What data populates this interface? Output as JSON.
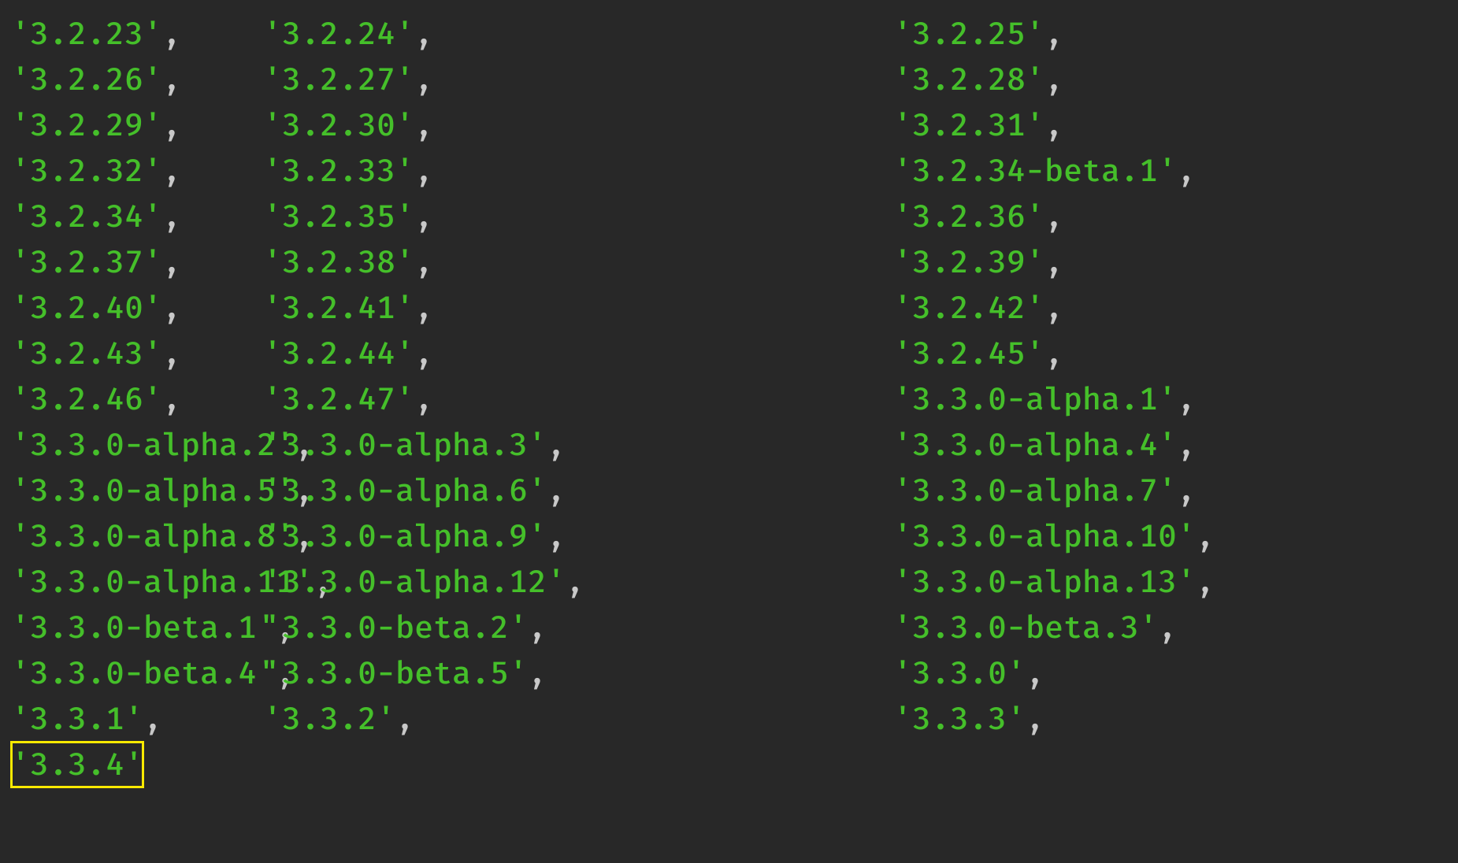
{
  "colors": {
    "bg": "#282828",
    "string": "#45bf2a",
    "punct": "#c8c8c8",
    "selection": "#f9e900"
  },
  "selected_row": 16,
  "selected_col": 0,
  "rows": [
    {
      "c1": "3.2.23",
      "c2": "3.2.24",
      "c3": "3.2.25"
    },
    {
      "c1": "3.2.26",
      "c2": "3.2.27",
      "c3": "3.2.28"
    },
    {
      "c1": "3.2.29",
      "c2": "3.2.30",
      "c3": "3.2.31"
    },
    {
      "c1": "3.2.32",
      "c2": "3.2.33",
      "c3": "3.2.34-beta.1"
    },
    {
      "c1": "3.2.34",
      "c2": "3.2.35",
      "c3": "3.2.36"
    },
    {
      "c1": "3.2.37",
      "c2": "3.2.38",
      "c3": "3.2.39"
    },
    {
      "c1": "3.2.40",
      "c2": "3.2.41",
      "c3": "3.2.42"
    },
    {
      "c1": "3.2.43",
      "c2": "3.2.44",
      "c3": "3.2.45"
    },
    {
      "c1": "3.2.46",
      "c2": "3.2.47",
      "c3": "3.3.0-alpha.1"
    },
    {
      "c1": "3.3.0-alpha.2",
      "c2": "3.3.0-alpha.3",
      "c3": "3.3.0-alpha.4"
    },
    {
      "c1": "3.3.0-alpha.5",
      "c2": "3.3.0-alpha.6",
      "c3": "3.3.0-alpha.7"
    },
    {
      "c1": "3.3.0-alpha.8",
      "c2": "3.3.0-alpha.9",
      "c3": "3.3.0-alpha.10"
    },
    {
      "c1": "3.3.0-alpha.11",
      "c2": "3.3.0-alpha.12",
      "c3": "3.3.0-alpha.13"
    },
    {
      "c1": "3.3.0-beta.1",
      "c2": "3.3.0-beta.2",
      "c3": "3.3.0-beta.3"
    },
    {
      "c1": "3.3.0-beta.4",
      "c2": "3.3.0-beta.5",
      "c3": "3.3.0"
    },
    {
      "c1": "3.3.1",
      "c2": "3.3.2",
      "c3": "3.3.3"
    },
    {
      "c1": "3.3.4",
      "c2": null,
      "c3": null
    }
  ]
}
